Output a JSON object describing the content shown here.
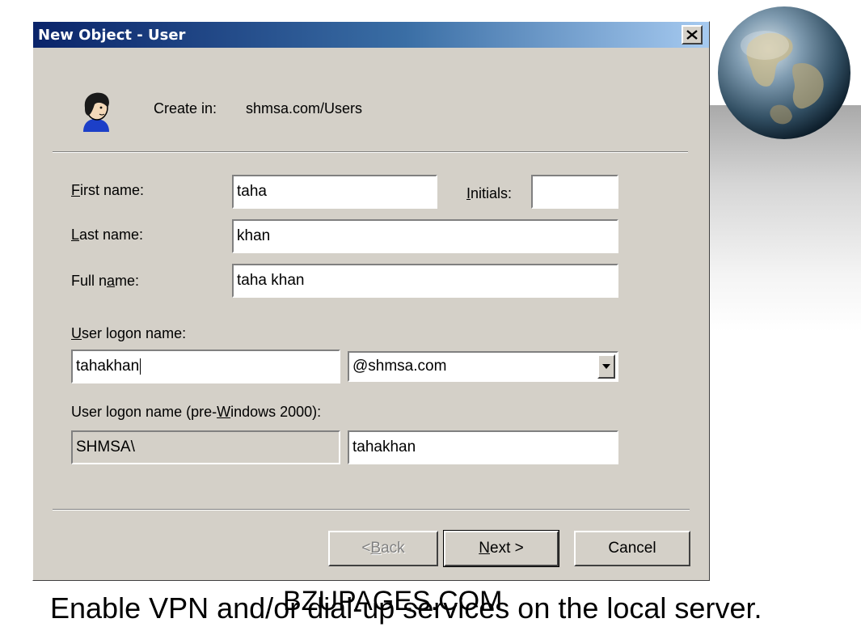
{
  "window": {
    "title": "New Object - User"
  },
  "create_in": {
    "label": "Create in:",
    "path": "shmsa.com/Users"
  },
  "form": {
    "first_name": {
      "label_pre": "",
      "label_accel": "F",
      "label_post": "irst name:",
      "value": "taha"
    },
    "initials": {
      "label_pre": "",
      "label_accel": "I",
      "label_post": "nitials:",
      "value": ""
    },
    "last_name": {
      "label_pre": "",
      "label_accel": "L",
      "label_post": "ast name:",
      "value": "khan"
    },
    "full_name": {
      "label_pre": "Full n",
      "label_accel": "a",
      "label_post": "me:",
      "value": "taha khan"
    },
    "logon_name": {
      "label_pre": "",
      "label_accel": "U",
      "label_post": "ser logon name:",
      "value": "tahakhan",
      "domain_selected": "@shmsa.com"
    },
    "pre2000": {
      "label_pre": "User logon name (pre-",
      "label_accel": "W",
      "label_post": "indows 2000):",
      "domain_prefix": "SHMSA\\",
      "value": "tahakhan"
    }
  },
  "buttons": {
    "back": {
      "pre": "< ",
      "accel": "B",
      "post": "ack"
    },
    "next": {
      "pre": "",
      "accel": "N",
      "post": "ext >"
    },
    "cancel": {
      "label": "Cancel"
    }
  },
  "slide": {
    "caption": "Enable VPN and/or dial-up services  on the local server.",
    "watermark": "BZUPAGES.COM"
  },
  "colors": {
    "dialog_bg": "#d4d0c8",
    "titlebar_start": "#0a246a",
    "titlebar_end": "#a6caf0"
  }
}
